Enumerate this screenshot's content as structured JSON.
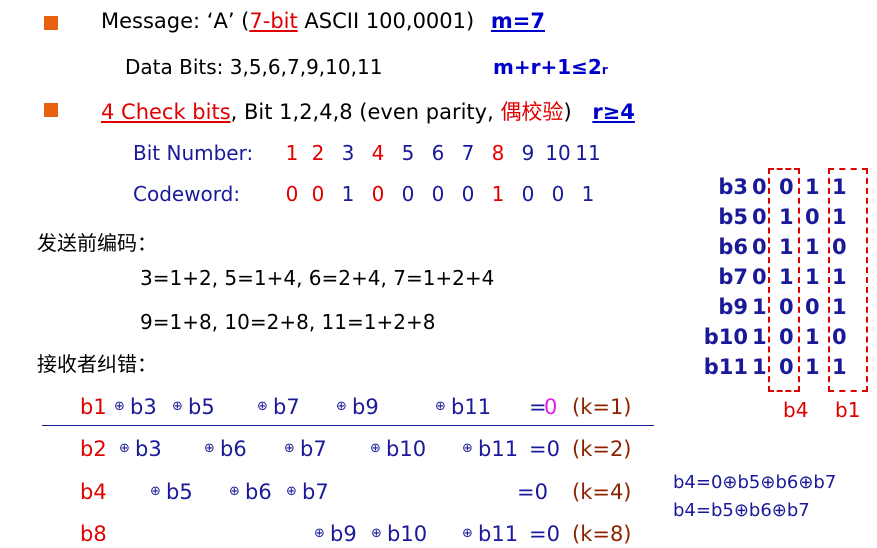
{
  "line1": {
    "prefix": "Message: ‘A’ (",
    "seven_bit": "7-bit",
    "rest": " ASCII 100,0001)",
    "m": "m=7"
  },
  "line2": {
    "data_bits": "Data Bits: 3,5,6,7,9,10,11",
    "formula": "m+r+1≤2",
    "sup": "r"
  },
  "line3": {
    "check_bits": "4 Check bits",
    "rest": ", Bit 1,2,4,8  (even parity, ",
    "cn": "偶校验",
    "close": ")",
    "r_geq": "r≥4"
  },
  "bit_number": {
    "label": "Bit Number:",
    "values": [
      "1",
      "2",
      "3",
      "4",
      "5",
      "6",
      "7",
      "8",
      "9",
      "10",
      "11"
    ],
    "red_indices": [
      0,
      1,
      3,
      7
    ]
  },
  "codeword": {
    "label": "Codeword:",
    "values": [
      "0",
      "0",
      "1",
      "0",
      "0",
      "0",
      "0",
      "1",
      "0",
      "0",
      "1"
    ],
    "red_indices": [
      0,
      1,
      3,
      7
    ]
  },
  "encode_heading": "发送前编码：",
  "encode_line1": "3=1+2,   5=1+4,   6=2+4,   7=1+2+4",
  "encode_line2": "9=1+8,   10=2+8,   11=1+2+8",
  "decode_heading": "接收者纠错：",
  "table": {
    "rows": [
      {
        "label": "b3",
        "bits": [
          "0",
          "0",
          "1",
          "1"
        ]
      },
      {
        "label": "b5",
        "bits": [
          "0",
          "1",
          "0",
          "1"
        ]
      },
      {
        "label": "b6",
        "bits": [
          "0",
          "1",
          "1",
          "0"
        ]
      },
      {
        "label": "b7",
        "bits": [
          "0",
          "1",
          "1",
          "1"
        ]
      },
      {
        "label": "b9",
        "bits": [
          "1",
          "0",
          "0",
          "1"
        ]
      },
      {
        "label": "b10",
        "bits": [
          "1",
          "0",
          "1",
          "0"
        ]
      },
      {
        "label": "b11",
        "bits": [
          "1",
          "0",
          "1",
          "1"
        ]
      }
    ],
    "b4_label": "b4",
    "b1_label": "b1"
  },
  "equations": [
    {
      "first": "b1",
      "terms": [
        "b3",
        "b5",
        "b7",
        "b9",
        "b11"
      ],
      "result": "=0",
      "k": "(k=1)"
    },
    {
      "first": "b2",
      "terms": [
        "b3",
        "b6",
        "b7",
        "b10",
        "b11"
      ],
      "result": "=0",
      "k": "(k=2)"
    },
    {
      "first": "b4",
      "terms": [
        "b5",
        "b6",
        "b7"
      ],
      "result": "=0",
      "k": "(k=4)"
    },
    {
      "first": "b8",
      "terms": [
        "b9",
        "b10",
        "b11"
      ],
      "result": "=0",
      "k": "(k=8)"
    }
  ],
  "xor_symbol": "⊕",
  "side_note": {
    "line1": "b4=0⊕b5⊕b6⊕b7",
    "line2": "b4=b5⊕b6⊕b7"
  }
}
